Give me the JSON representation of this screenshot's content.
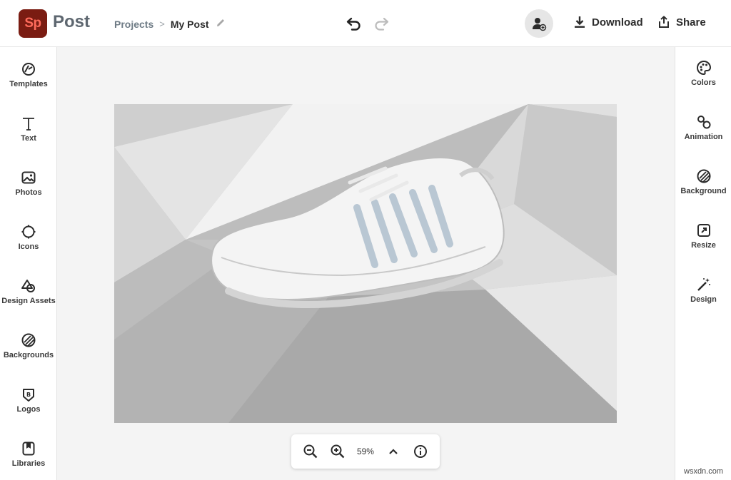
{
  "app": {
    "logo_text": "Sp",
    "name": "Post",
    "brand_color": "#7a1c12",
    "logo_text_color": "#ff6b5b"
  },
  "breadcrumb": {
    "projects_label": "Projects",
    "separator": ">",
    "current_label": "My Post"
  },
  "toolbar": {
    "undo_icon": "undo-icon",
    "redo_icon": "redo-icon",
    "invite_icon": "add-person-icon",
    "download_label": "Download",
    "share_label": "Share"
  },
  "left_sidebar": {
    "items": [
      {
        "label": "Templates",
        "icon": "templates-icon"
      },
      {
        "label": "Text",
        "icon": "text-icon"
      },
      {
        "label": "Photos",
        "icon": "photos-icon"
      },
      {
        "label": "Icons",
        "icon": "icons-icon"
      },
      {
        "label": "Design Assets",
        "icon": "design-assets-icon"
      },
      {
        "label": "Backgrounds",
        "icon": "backgrounds-icon"
      },
      {
        "label": "Logos",
        "icon": "logos-icon"
      },
      {
        "label": "Libraries",
        "icon": "libraries-icon"
      }
    ]
  },
  "right_sidebar": {
    "items": [
      {
        "label": "Colors",
        "icon": "palette-icon"
      },
      {
        "label": "Animation",
        "icon": "animation-icon"
      },
      {
        "label": "Background",
        "icon": "background-icon"
      },
      {
        "label": "Resize",
        "icon": "resize-icon"
      },
      {
        "label": "Design",
        "icon": "magic-wand-icon"
      }
    ]
  },
  "canvas": {
    "content": "white sneaker on grey polygon background"
  },
  "zoom": {
    "zoom_out_icon": "zoom-out-icon",
    "zoom_in_icon": "zoom-in-icon",
    "value": "59%",
    "expand_icon": "chevron-up-icon",
    "info_icon": "info-icon"
  },
  "watermark": "wsxdn.com"
}
